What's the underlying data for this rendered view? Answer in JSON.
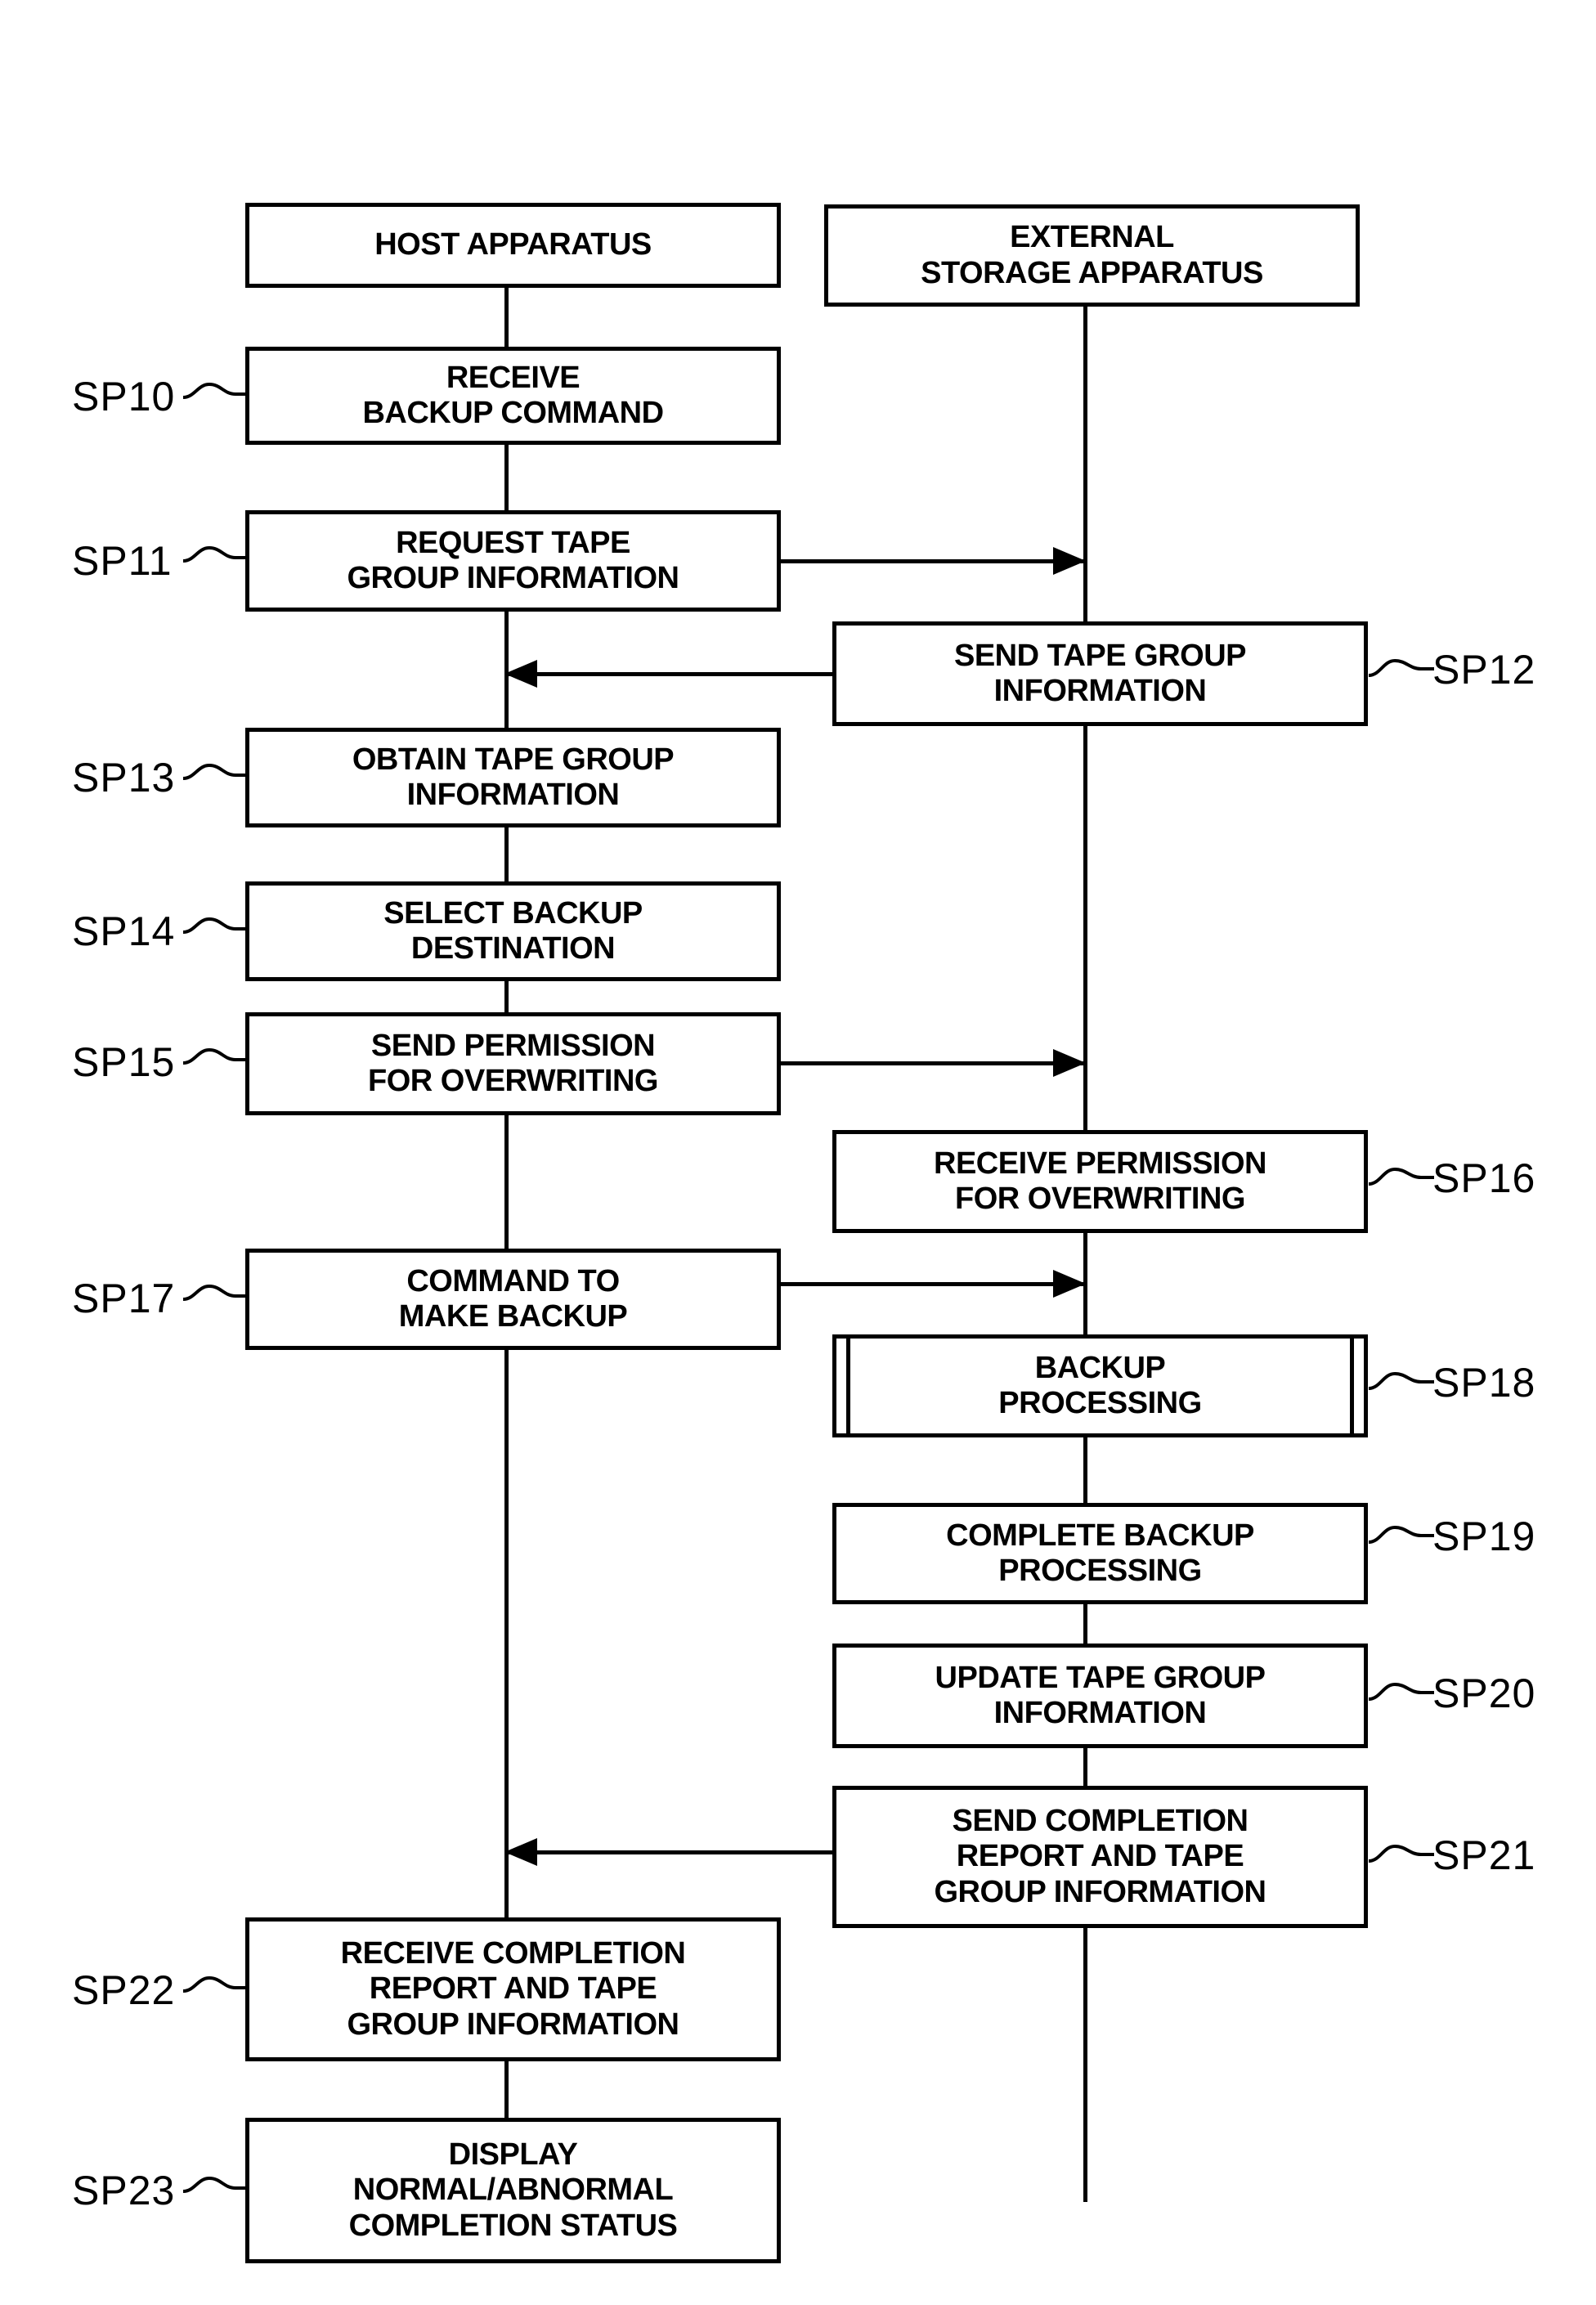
{
  "figure": {
    "type": "sequence-flowchart",
    "lanes": [
      {
        "id": "host",
        "title": "HOST APPARATUS"
      },
      {
        "id": "external",
        "title": "EXTERNAL\nSTORAGE APPARATUS"
      }
    ]
  },
  "steps": {
    "sp10": {
      "ref": "SP10",
      "text": "RECEIVE\nBACKUP COMMAND",
      "lane": "host"
    },
    "sp11": {
      "ref": "SP11",
      "text": "REQUEST TAPE\nGROUP INFORMATION",
      "lane": "host"
    },
    "sp12": {
      "ref": "SP12",
      "text": "SEND TAPE GROUP\nINFORMATION",
      "lane": "external"
    },
    "sp13": {
      "ref": "SP13",
      "text": "OBTAIN TAPE GROUP\nINFORMATION",
      "lane": "host"
    },
    "sp14": {
      "ref": "SP14",
      "text": "SELECT BACKUP\nDESTINATION",
      "lane": "host"
    },
    "sp15": {
      "ref": "SP15",
      "text": "SEND PERMISSION\nFOR OVERWRITING",
      "lane": "host"
    },
    "sp16": {
      "ref": "SP16",
      "text": "RECEIVE PERMISSION\nFOR OVERWRITING",
      "lane": "external"
    },
    "sp17": {
      "ref": "SP17",
      "text": "COMMAND TO\nMAKE BACKUP",
      "lane": "host"
    },
    "sp18": {
      "ref": "SP18",
      "text": "BACKUP\nPROCESSING",
      "lane": "external",
      "shape": "predefined-process"
    },
    "sp19": {
      "ref": "SP19",
      "text": "COMPLETE BACKUP\nPROCESSING",
      "lane": "external"
    },
    "sp20": {
      "ref": "SP20",
      "text": "UPDATE TAPE GROUP\nINFORMATION",
      "lane": "external"
    },
    "sp21": {
      "ref": "SP21",
      "text": "SEND COMPLETION\nREPORT AND TAPE\nGROUP INFORMATION",
      "lane": "external"
    },
    "sp22": {
      "ref": "SP22",
      "text": "RECEIVE COMPLETION\nREPORT AND TAPE\nGROUP INFORMATION",
      "lane": "host"
    },
    "sp23": {
      "ref": "SP23",
      "text": "DISPLAY\nNORMAL/ABNORMAL\nCOMPLETION STATUS",
      "lane": "host"
    }
  },
  "messages": [
    {
      "id": "m1",
      "from": "sp11",
      "to": "external",
      "direction": "right"
    },
    {
      "id": "m2",
      "from": "sp12",
      "to": "host",
      "direction": "left"
    },
    {
      "id": "m3",
      "from": "sp15",
      "to": "external",
      "direction": "right"
    },
    {
      "id": "m4",
      "from": "sp17",
      "to": "external",
      "direction": "right"
    },
    {
      "id": "m5",
      "from": "sp21",
      "to": "host",
      "direction": "left"
    }
  ],
  "colors": {
    "ink": "#000000",
    "paper": "#ffffff"
  }
}
